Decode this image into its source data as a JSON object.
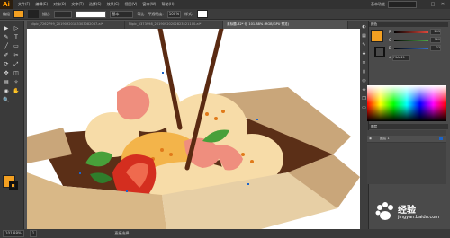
{
  "app": {
    "logo": "Ai"
  },
  "menu": [
    "文件(F)",
    "编辑(E)",
    "对象(O)",
    "文字(T)",
    "选择(S)",
    "效果(C)",
    "视图(V)",
    "窗口(W)",
    "帮助(H)"
  ],
  "window": {
    "workspace": "基本功能",
    "minimize": "—",
    "maximize": "□",
    "close": "✕"
  },
  "control_bar": {
    "selection_label": "编组",
    "stroke_label": "描边:",
    "stroke_style": "基本",
    "uniform_label": "等比",
    "opacity_label": "不透明度:",
    "opacity_value": "100%",
    "style_label": "样式:",
    "fill_color": "#f3a021"
  },
  "tabs": [
    {
      "label": "Nipic_7262799_20190920183303082037.ai*",
      "active": false
    },
    {
      "label": "Nipic_5373998_20190920202823521100.ai*",
      "active": false
    },
    {
      "label": "未标题-32* @ 101.88% (RGB/GPU 预览)",
      "active": true
    }
  ],
  "status": {
    "zoom": "101.88%",
    "page": "1",
    "tool_name": "直接选择"
  },
  "color_panel": {
    "title": "颜色",
    "rows": [
      {
        "label": "R",
        "value": "243",
        "color": "#e0493d"
      },
      {
        "label": "G",
        "value": "160",
        "color": "#4fa94b"
      },
      {
        "label": "B",
        "value": "33",
        "color": "#3a6fc9"
      }
    ],
    "hex": "F3A021"
  },
  "layers_panel": {
    "title": "图层",
    "layer_name": "图层 1"
  },
  "watermark": {
    "brand": "经验",
    "url": "jingyan.baidu.com"
  },
  "tools": [
    "▶",
    "▷",
    "✎",
    "T",
    "╱",
    "▭",
    "✐",
    "✂",
    "⟳",
    "⤢",
    "✥",
    "◫",
    "▤",
    "✧",
    "◉",
    "✋",
    "🔍"
  ]
}
